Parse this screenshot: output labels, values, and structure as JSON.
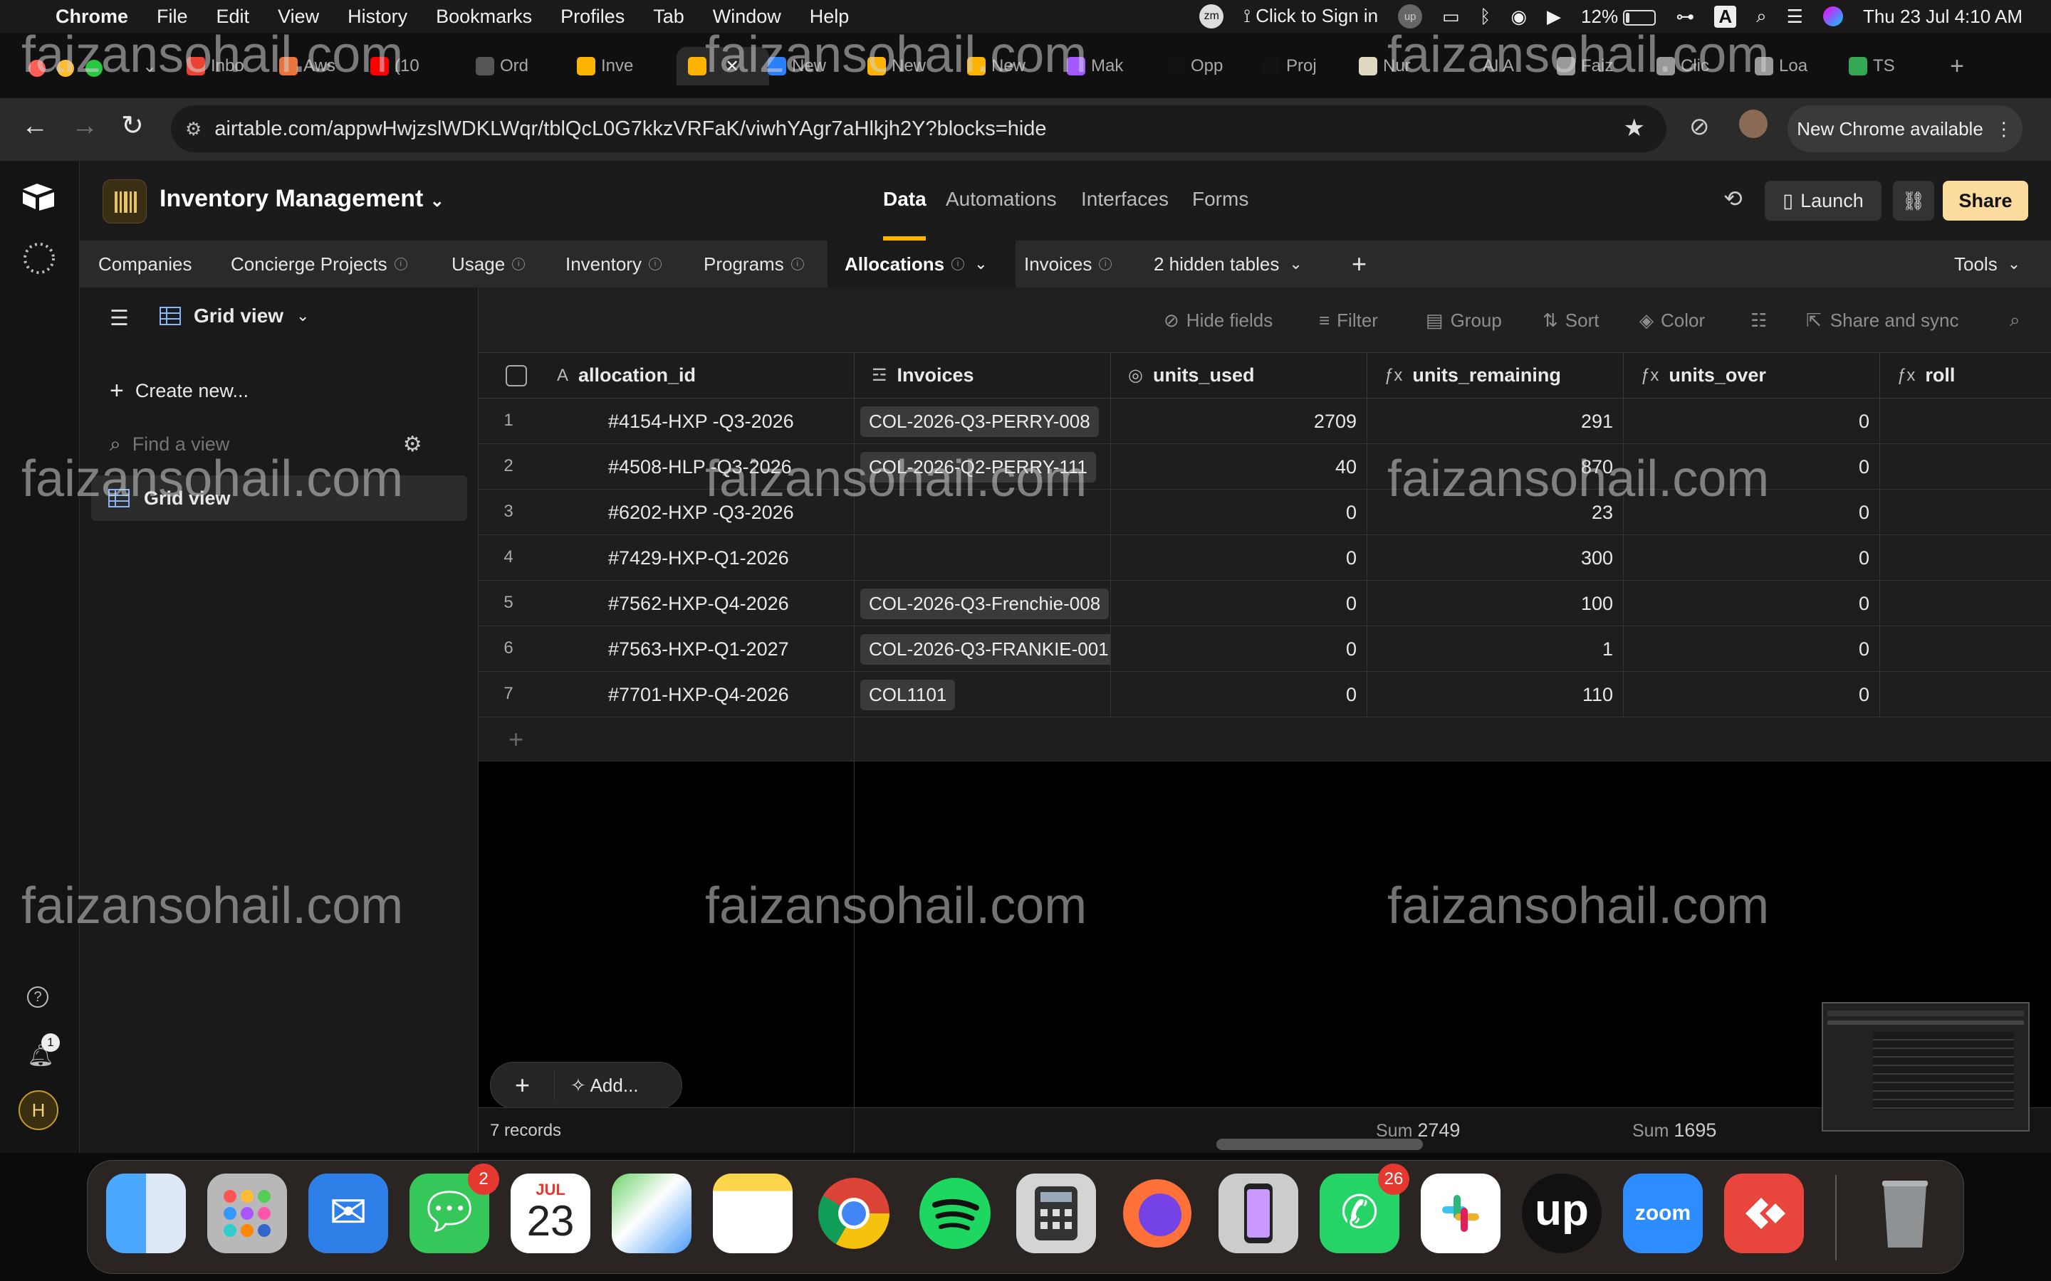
{
  "menubar": {
    "app": "Chrome",
    "items": [
      "File",
      "Edit",
      "View",
      "History",
      "Bookmarks",
      "Profiles",
      "Tab",
      "Window",
      "Help"
    ],
    "sign_in": "Click to Sign in",
    "battery": "12%",
    "keyboard": "A",
    "datetime": "Thu 23 Jul  4:10 AM"
  },
  "tabs": [
    {
      "label": "Inbo",
      "color": "#ea4335"
    },
    {
      "label": "Aws",
      "color": "#e8743b"
    },
    {
      "label": "(10",
      "color": "#ff0000"
    },
    {
      "label": "Ord",
      "color": "#555555"
    },
    {
      "label": "Inve",
      "color": "#fcb400"
    },
    {
      "label": "",
      "color": "#fcb400"
    },
    {
      "label": "New",
      "color": "#2d7ff9"
    },
    {
      "label": "New",
      "color": "#fcb400"
    },
    {
      "label": "New",
      "color": "#fcb400"
    },
    {
      "label": "Mak",
      "color": "#a259ff"
    },
    {
      "label": "Opp",
      "color": "#111111"
    },
    {
      "label": "Proj",
      "color": "#111111"
    },
    {
      "label": "Nur",
      "color": "#e0d8c0"
    },
    {
      "label": "AI A",
      "color": "#111111"
    },
    {
      "label": "Faiz",
      "color": "#999999"
    },
    {
      "label": "Clic",
      "color": "#999999"
    },
    {
      "label": "Loa",
      "color": "#999999"
    },
    {
      "label": "TS",
      "color": "#34a853"
    }
  ],
  "address": {
    "url": "airtable.com/appwHwjzslWDKLWqr/tblQcL0G7kkzVRFaK/viwhYAgr7aHlkjh2Y?blocks=hide",
    "new_chrome": "New Chrome available"
  },
  "base": {
    "name": "Inventory Management",
    "nav": [
      "Data",
      "Automations",
      "Interfaces",
      "Forms"
    ],
    "launch": "Launch",
    "share": "Share"
  },
  "tables": {
    "items": [
      "Companies",
      "Concierge Projects",
      "Usage",
      "Inventory",
      "Programs",
      "Allocations",
      "Invoices"
    ],
    "hidden": "2 hidden tables",
    "tools": "Tools"
  },
  "sidebar": {
    "view_name": "Grid view",
    "create_new": "Create new...",
    "find_placeholder": "Find a view",
    "views": [
      "Grid view"
    ],
    "notification_count": "1",
    "avatar": "H"
  },
  "toolbar": {
    "hide_fields": "Hide fields",
    "filter": "Filter",
    "group": "Group",
    "sort": "Sort",
    "color": "Color",
    "share_sync": "Share and sync"
  },
  "grid": {
    "columns": [
      "allocation_id",
      "Invoices",
      "units_used",
      "units_remaining",
      "units_over",
      "roll"
    ],
    "rows": [
      {
        "n": "1",
        "id": "#4154-HXP -Q3-2026",
        "inv": "COL-2026-Q3-PERRY-008",
        "used": "2709",
        "rem": "291",
        "over": "0"
      },
      {
        "n": "2",
        "id": "#4508-HLP -Q3-2026",
        "inv": "COL-2026-Q2-PERRY-111",
        "used": "40",
        "rem": "870",
        "over": "0"
      },
      {
        "n": "3",
        "id": "#6202-HXP -Q3-2026",
        "inv": "",
        "used": "0",
        "rem": "23",
        "over": "0"
      },
      {
        "n": "4",
        "id": "#7429-HXP-Q1-2026",
        "inv": "",
        "used": "0",
        "rem": "300",
        "over": "0"
      },
      {
        "n": "5",
        "id": "#7562-HXP-Q4-2026",
        "inv": "COL-2026-Q3-Frenchie-008",
        "used": "0",
        "rem": "100",
        "over": "0"
      },
      {
        "n": "6",
        "id": "#7563-HXP-Q1-2027",
        "inv": "COL-2026-Q3-FRANKIE-001",
        "used": "0",
        "rem": "1",
        "over": "0"
      },
      {
        "n": "7",
        "id": "#7701-HXP-Q4-2026",
        "inv": "COL1101",
        "used": "0",
        "rem": "110",
        "over": "0"
      }
    ],
    "add_label": "Add...",
    "records": "7 records",
    "sum_label": "Sum",
    "sum_used": "2749",
    "sum_remaining": "1695"
  },
  "watermark": "faizansohail.com",
  "dock": {
    "messages_badge": "2",
    "calendar_month": "JUL",
    "calendar_day": "23",
    "whatsapp_badge": "26",
    "zoom": "zoom"
  }
}
